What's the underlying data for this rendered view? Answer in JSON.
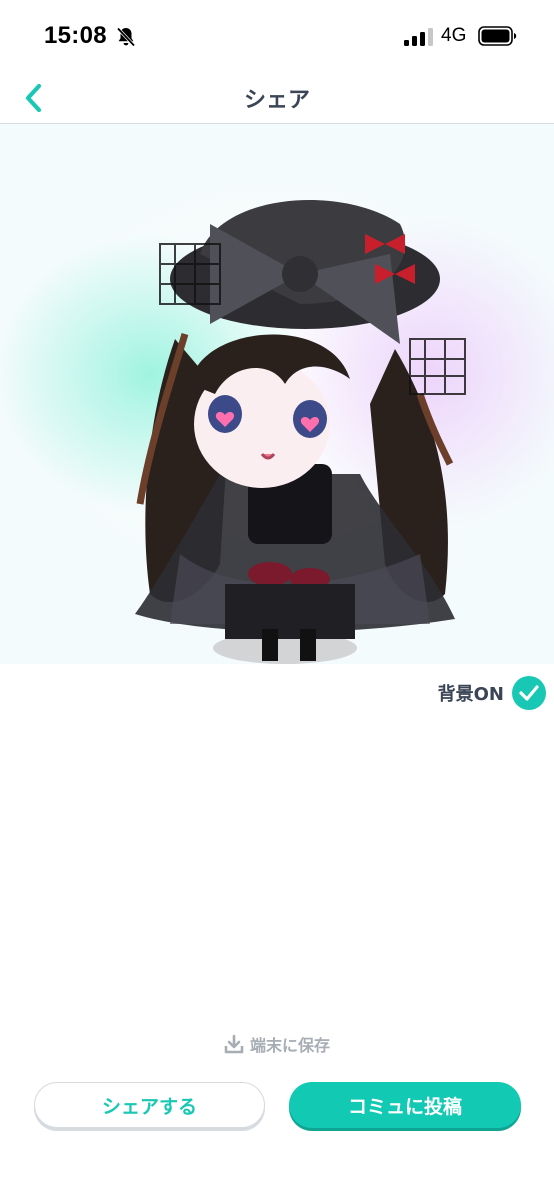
{
  "status_bar": {
    "time": "15:08",
    "network": "4G",
    "icons": [
      "bell-slash-icon",
      "signal-icon",
      "battery-icon"
    ]
  },
  "nav": {
    "title": "シェア",
    "back_icon": "chevron-left-icon"
  },
  "preview": {
    "description_icon": "avatar-image"
  },
  "background_toggle": {
    "label": "背景ON",
    "checked": true
  },
  "save": {
    "label": "端末に保存",
    "icon": "download-icon"
  },
  "buttons": {
    "share_label": "シェアする",
    "post_label": "コミュに投稿"
  },
  "colors": {
    "accent": "#18c8b4",
    "text": "#3b4556",
    "muted": "#a7adb5"
  }
}
